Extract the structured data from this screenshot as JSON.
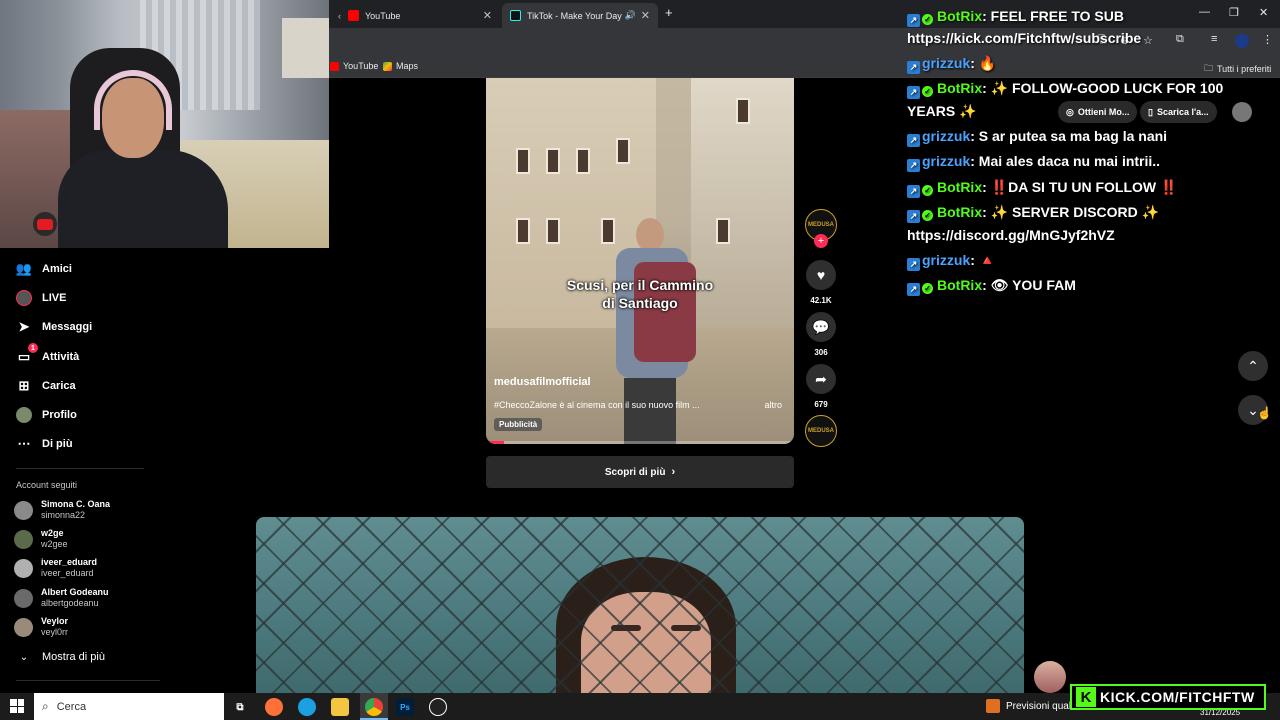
{
  "browser": {
    "tabs": [
      {
        "label": "YouTube",
        "active": false
      },
      {
        "label": "TikTok - Make Your Day",
        "active": true
      }
    ],
    "bookmarks": [
      "YouTube",
      "Maps"
    ],
    "all_bookmarks": "Tutti i preferiti",
    "new_tab": "+"
  },
  "sidebar": {
    "items": [
      {
        "label": "Amici",
        "icon": "friends-icon"
      },
      {
        "label": "LIVE",
        "icon": "live-icon"
      },
      {
        "label": "Messaggi",
        "icon": "messages-icon"
      },
      {
        "label": "Attività",
        "icon": "activity-icon",
        "badge": "1"
      },
      {
        "label": "Carica",
        "icon": "upload-icon"
      },
      {
        "label": "Profilo",
        "icon": "profile-icon"
      },
      {
        "label": "Di più",
        "icon": "more-icon"
      }
    ],
    "following_title": "Account seguiti",
    "following": [
      {
        "name": "Simona C. Oana",
        "handle": "simonna22"
      },
      {
        "name": "w2ge",
        "handle": "w2gee"
      },
      {
        "name": "iveer_eduard",
        "handle": "iveer_eduard"
      },
      {
        "name": "Albert Godeanu",
        "handle": "albertgodeanu"
      },
      {
        "name": "Veylor",
        "handle": "veyl0rr"
      }
    ],
    "show_more": "Mostra di più"
  },
  "video": {
    "subtitle_line1": "Scusi, per il Cammino",
    "subtitle_line2": "di Santiago",
    "author": "medusafilmofficial",
    "description": "#CheccoZalone è al cinema con il suo nuovo film ...",
    "more": "altro",
    "ad_label": "Pubblicità",
    "cta": "Scopri di più",
    "progress": 0.06
  },
  "actions": {
    "avatar_text": "MEDUSA",
    "likes": "42.1K",
    "comments": "306",
    "shares": "679"
  },
  "topbar": {
    "get_coins": "Ottieni Mo...",
    "download_app": "Scarica l'a..."
  },
  "chat": {
    "lines": [
      {
        "user": "BotRix",
        "text": ": FEEL FREE TO SUB",
        "kind": "bot"
      },
      {
        "user": "",
        "text": "https://kick.com/Fitchftw/subscribe",
        "kind": "cont"
      },
      {
        "user": "grizzuk",
        "text": ": 🔥",
        "kind": "user"
      },
      {
        "user": "BotRix",
        "text": ": ✨ FOLLOW-GOOD LUCK FOR 100",
        "kind": "bot"
      },
      {
        "user": "",
        "text": "YEARS ✨",
        "kind": "cont"
      },
      {
        "user": "grizzuk",
        "text": ": S ar putea sa ma bag la nani",
        "kind": "user"
      },
      {
        "user": "grizzuk",
        "text": ": Mai ales daca nu mai intrii..",
        "kind": "user"
      },
      {
        "user": "BotRix",
        "text": ": ‼️DA SI TU UN FOLLOW ‼️",
        "kind": "bot"
      },
      {
        "user": "BotRix",
        "text": ": ✨ SERVER DISCORD ✨",
        "kind": "bot"
      },
      {
        "user": "",
        "text": "https://discord.gg/MnGJyf2hVZ",
        "kind": "cont"
      },
      {
        "user": "grizzuk",
        "text": ": 🔺",
        "kind": "user"
      },
      {
        "user": "BotRix",
        "text": ": 👁 YOU FAM",
        "kind": "bot"
      }
    ]
  },
  "overlay": {
    "kick_text": "KICK.COM/FITCHFTW",
    "kick_letter": "K"
  },
  "taskbar": {
    "search_placeholder": "Cerca",
    "weather": "Previsioni qualit",
    "date": "31/12/2025"
  }
}
